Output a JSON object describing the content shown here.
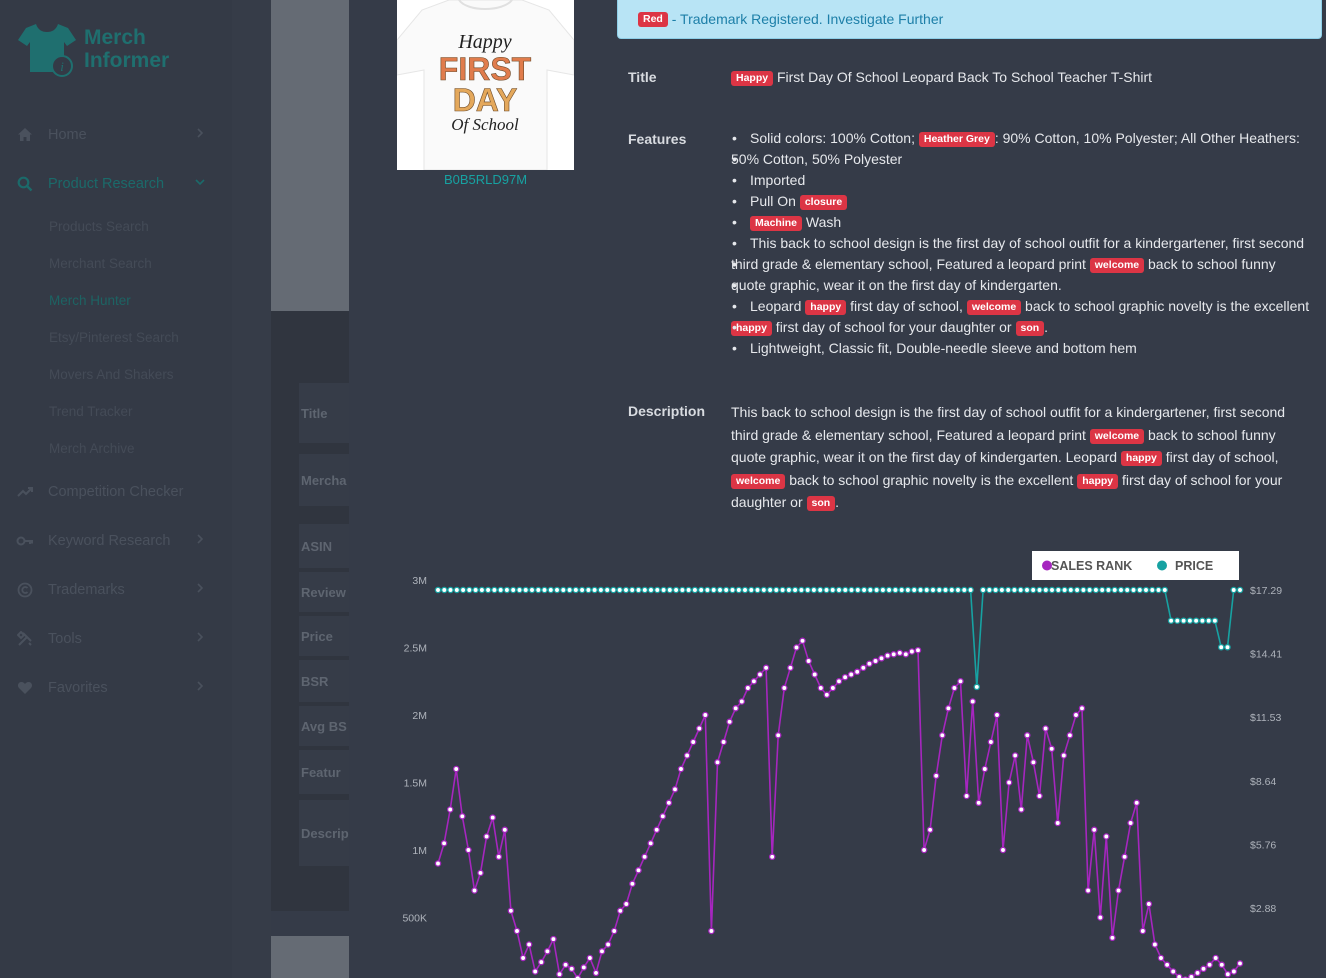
{
  "app": {
    "logo_line1": "Merch",
    "logo_line2": "Informer"
  },
  "sidebar": {
    "items": [
      {
        "label": "Home",
        "icon": "home-icon",
        "chevron": true
      },
      {
        "label": "Product Research",
        "icon": "search-icon",
        "chevron": true,
        "expanded": true,
        "sub": [
          "Products Search",
          "Merchant Search",
          "Merch Hunter",
          "Etsy/Pinterest Search",
          "Movers And Shakers",
          "Trend Tracker",
          "Merch Archive"
        ],
        "active_sub": "Merch Hunter"
      },
      {
        "label": "Competition Checker",
        "icon": "trend-up-icon",
        "chevron": false
      },
      {
        "label": "Keyword Research",
        "icon": "key-icon",
        "chevron": true
      },
      {
        "label": "Trademarks",
        "icon": "copyright-icon",
        "chevron": true
      },
      {
        "label": "Tools",
        "icon": "tools-icon",
        "chevron": true
      },
      {
        "label": "Favorites",
        "icon": "heart-icon",
        "chevron": true
      }
    ]
  },
  "background_rows": [
    "Title",
    "Mercha",
    "ASIN",
    "Review",
    "Price",
    "BSR",
    "Avg BS",
    "Featur",
    "Descrip"
  ],
  "product": {
    "asin": "B0B5RLD97M",
    "shirt_text": [
      "Happy",
      "FIRST",
      "DAY",
      "Of School"
    ]
  },
  "alert": {
    "badge": "Red",
    "text": " - Trademark Registered. Investigate Further"
  },
  "labels": {
    "title": "Title",
    "features": "Features",
    "description": "Description"
  },
  "title": {
    "badge": "Happy",
    "text": " First Day Of School Leopard Back To School Teacher T-Shirt"
  },
  "features": {
    "f1a": "Solid colors: 100% Cotton; ",
    "f1b": "Heather Grey",
    "f1c": ": 90% Cotton, 10% Polyester; All Other Heathers:",
    "f1d": "50% Cotton, 50% Polyester",
    "f2": "Imported",
    "f3a": "Pull On ",
    "f3b": "closure",
    "f4a": "Machine",
    "f4b": " Wash",
    "f5a": "This back to school design is the first day of school outfit for a kindergartener, first second",
    "f5b": "third grade & elementary school, Featured a leopard print ",
    "f5c": "welcome",
    "f5d": " back to school funny",
    "f5e": "quote graphic, wear it on the first day of kindergarten.",
    "f6a": "Leopard ",
    "f6b": "happy",
    "f6c": " first day of school, ",
    "f6d": "welcome",
    "f6e": " back to school graphic novelty is the excellent",
    "f6f": "happy",
    "f6g": " first day of school for your daughter or ",
    "f6h": "son",
    "f6i": ".",
    "f7": "Lightweight, Classic fit, Double-needle sleeve and bottom hem"
  },
  "description": {
    "d1": "This back to school design is the first day of school outfit for a kindergartener, first second",
    "d2": "third grade & elementary school, Featured a leopard print ",
    "d3": "welcome",
    "d4": " back to school funny",
    "d5": "quote graphic, wear it on the first day of kindergarten. Leopard ",
    "d6": "happy",
    "d7": " first day of school,",
    "d8": "welcome",
    "d9": " back to school graphic novelty is the excellent ",
    "d10": "happy",
    "d11": " first day of school for your",
    "d12": "daughter or ",
    "d13": "son",
    "d14": "."
  },
  "colors": {
    "sales_rank": "#a626bf",
    "price": "#17a2a2",
    "badge": "#dc3545",
    "accent": "#17a2a2"
  },
  "chart_data": {
    "type": "line",
    "legend": {
      "position": "top-right",
      "entries": [
        "SALES RANK",
        "PRICE"
      ]
    },
    "left_axis": {
      "ticks": [
        "3M",
        "2.5M",
        "2M",
        "1.5M",
        "1M",
        "500K"
      ],
      "values": [
        3000000,
        2500000,
        2000000,
        1500000,
        1000000,
        500000
      ],
      "range": [
        0,
        3000000
      ]
    },
    "right_axis": {
      "ticks": [
        "$17.29",
        "$14.41",
        "$11.53",
        "$8.64",
        "$5.76",
        "$2.88"
      ],
      "values": [
        17.29,
        14.41,
        11.53,
        8.64,
        5.76,
        2.88
      ],
      "range": [
        0,
        17.29
      ]
    },
    "grid": false,
    "series": [
      {
        "name": "SALES RANK",
        "axis": "left",
        "values": [
          900000,
          1050000,
          1300000,
          1600000,
          1250000,
          1000000,
          700000,
          830000,
          1100000,
          1240000,
          950000,
          1150000,
          550000,
          400000,
          200000,
          300000,
          100000,
          170000,
          250000,
          340000,
          80000,
          150000,
          120000,
          50000,
          130000,
          200000,
          90000,
          250000,
          300000,
          400000,
          550000,
          600000,
          750000,
          850000,
          950000,
          1050000,
          1150000,
          1250000,
          1350000,
          1450000,
          1600000,
          1700000,
          1800000,
          1900000,
          2000000,
          400000,
          1650000,
          1800000,
          1950000,
          2050000,
          2100000,
          2200000,
          2250000,
          2300000,
          2350000,
          950000,
          1850000,
          2200000,
          2350000,
          2500000,
          2550000,
          2400000,
          2300000,
          2200000,
          2150000,
          2200000,
          2250000,
          2280000,
          2300000,
          2320000,
          2350000,
          2380000,
          2400000,
          2420000,
          2440000,
          2450000,
          2460000,
          2450000,
          2470000,
          2480000,
          1000000,
          1150000,
          1550000,
          1850000,
          2050000,
          2200000,
          2250000,
          1400000,
          2100000,
          1350000,
          1600000,
          1800000,
          2000000,
          1000000,
          1500000,
          1700000,
          1300000,
          1850000,
          1650000,
          1400000,
          1900000,
          1750000,
          1200000,
          1700000,
          1850000,
          2000000,
          2050000,
          700000,
          1150000,
          500000,
          1100000,
          350000,
          700000,
          950000,
          1200000,
          1350000,
          400000,
          600000,
          300000,
          200000,
          150000,
          100000,
          60000,
          40000,
          60000,
          90000,
          120000,
          150000,
          200000,
          150000,
          80000,
          100000,
          160000
        ]
      },
      {
        "name": "PRICE",
        "axis": "right",
        "values": [
          17.29,
          17.29,
          17.29,
          17.29,
          17.29,
          17.29,
          17.29,
          17.29,
          17.29,
          17.29,
          17.29,
          17.29,
          17.29,
          17.29,
          17.29,
          17.29,
          17.29,
          17.29,
          17.29,
          17.29,
          17.29,
          17.29,
          17.29,
          17.29,
          17.29,
          17.29,
          17.29,
          17.29,
          17.29,
          17.29,
          17.29,
          17.29,
          17.29,
          17.29,
          17.29,
          17.29,
          17.29,
          17.29,
          17.29,
          17.29,
          17.29,
          17.29,
          17.29,
          17.29,
          17.29,
          17.29,
          17.29,
          17.29,
          17.29,
          17.29,
          17.29,
          17.29,
          17.29,
          17.29,
          17.29,
          17.29,
          17.29,
          17.29,
          17.29,
          17.29,
          17.29,
          17.29,
          17.29,
          17.29,
          17.29,
          17.29,
          17.29,
          17.29,
          17.29,
          17.29,
          17.29,
          17.29,
          17.29,
          17.29,
          17.29,
          17.29,
          17.29,
          17.29,
          17.29,
          17.29,
          17.29,
          17.29,
          17.29,
          17.29,
          17.29,
          17.29,
          12.9,
          17.29,
          17.29,
          17.29,
          17.29,
          17.29,
          17.29,
          17.29,
          17.29,
          17.29,
          17.29,
          17.29,
          17.29,
          17.29,
          17.29,
          17.29,
          17.29,
          17.29,
          17.29,
          17.29,
          17.29,
          17.29,
          17.29,
          17.29,
          17.29,
          17.29,
          17.29,
          17.29,
          17.29,
          17.29,
          17.29,
          15.9,
          15.9,
          15.9,
          15.9,
          15.9,
          15.9,
          15.9,
          15.9,
          14.7,
          14.7,
          17.29,
          17.29
        ]
      }
    ]
  }
}
